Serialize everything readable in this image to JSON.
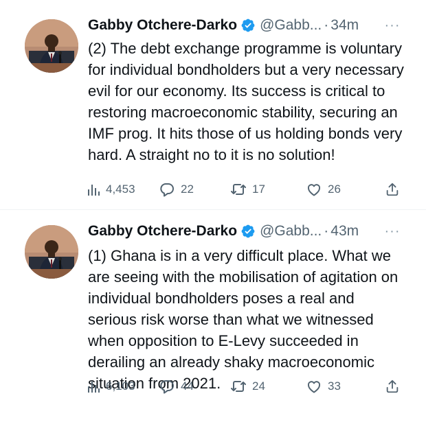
{
  "tweets": [
    {
      "author": "Gabby Otchere-Darko",
      "handle": "@Gabb...",
      "separator": "·",
      "time": "34m",
      "text": "(2) The debt exchange programme is voluntary for individual bondholders but a very necessary evil for our economy. Its success is critical to restoring macroeconomic stability, securing an IMF prog. It hits those of us holding bonds very hard. A straight no to it is no solution!",
      "views": "4,453",
      "replies": "22",
      "retweets": "17",
      "likes": "26"
    },
    {
      "author": "Gabby Otchere-Darko",
      "handle": "@Gabb...",
      "separator": "·",
      "time": "43m",
      "text": "(1) Ghana is in a very difficult place. What we are seeing with the mobilisation of agitation on individual bondholders poses a real and serious risk worse than what we witnessed when opposition to E-Levy succeeded in derailing an already shaky macroeconomic situation from 2021.",
      "views": "6,103",
      "replies": "44",
      "retweets": "24",
      "likes": "33"
    }
  ],
  "icons": {
    "verified": "verified-badge-icon",
    "more": "more-options-icon",
    "views": "views-icon",
    "reply": "reply-icon",
    "retweet": "retweet-icon",
    "like": "like-icon",
    "share": "share-icon"
  },
  "colors": {
    "verified": "#1d9bf0",
    "text": "#0f1419",
    "secondary": "#536471",
    "divider": "#eff3f4"
  }
}
